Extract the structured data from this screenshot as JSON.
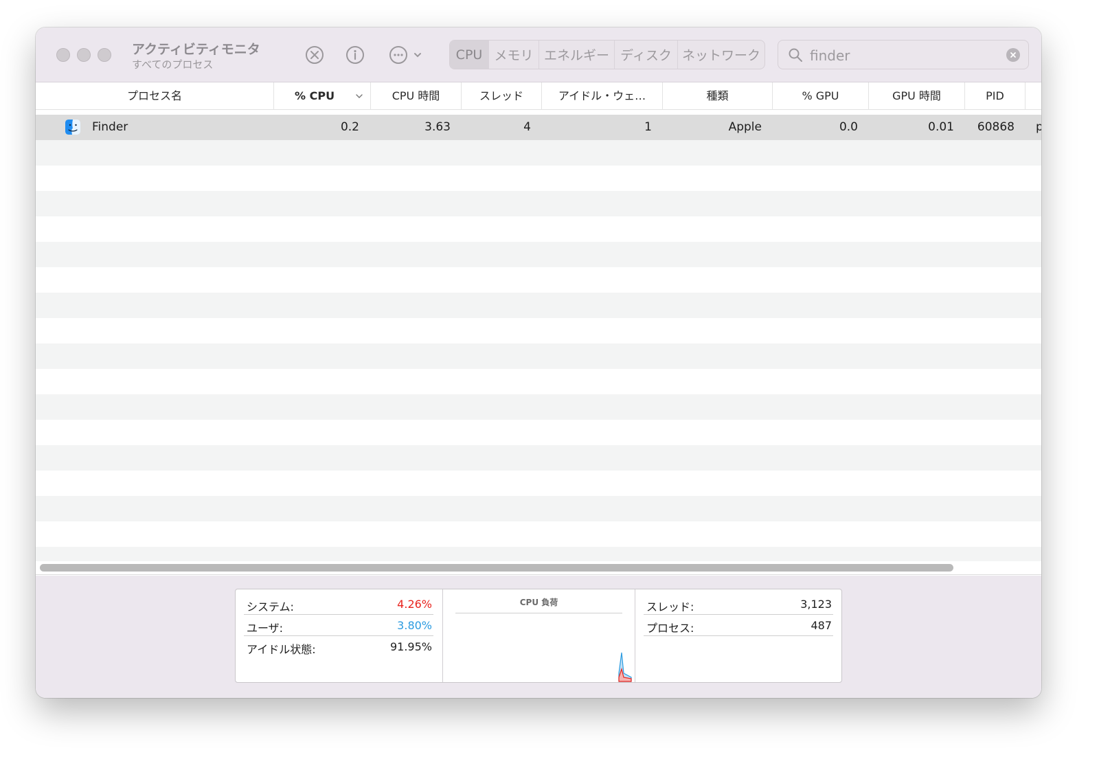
{
  "window": {
    "title": "アクティビティモニタ",
    "subtitle": "すべてのプロセス"
  },
  "tabs": [
    {
      "label": "CPU",
      "active": true
    },
    {
      "label": "メモリ",
      "active": false
    },
    {
      "label": "エネルギー",
      "active": false
    },
    {
      "label": "ディスク",
      "active": false
    },
    {
      "label": "ネットワーク",
      "active": false
    }
  ],
  "search": {
    "value": "finder"
  },
  "table": {
    "columns": [
      "プロセス名",
      "% CPU",
      "CPU 時間",
      "スレッド",
      "アイドル・ウェ…",
      "種類",
      "% GPU",
      "GPU 時間",
      "PID"
    ],
    "sorted_column": "% CPU",
    "rows": [
      {
        "name": "Finder",
        "cpu": "0.2",
        "cpu_time": "3.63",
        "threads": "4",
        "idle_wakeups": "1",
        "kind": "Apple",
        "gpu": "0.0",
        "gpu_time": "0.01",
        "pid": "60868",
        "user": "p"
      }
    ]
  },
  "cpu_stats": {
    "system_label": "システム:",
    "system_value": "4.26%",
    "user_label": "ユーザ:",
    "user_value": "3.80%",
    "idle_label": "アイドル状態:",
    "idle_value": "91.95%"
  },
  "graph": {
    "title": "CPU 負荷"
  },
  "process_stats": {
    "threads_label": "スレッド:",
    "threads_value": "3,123",
    "processes_label": "プロセス:",
    "processes_value": "487"
  },
  "colors": {
    "system": "#e8231d",
    "user": "#2b9be0"
  }
}
